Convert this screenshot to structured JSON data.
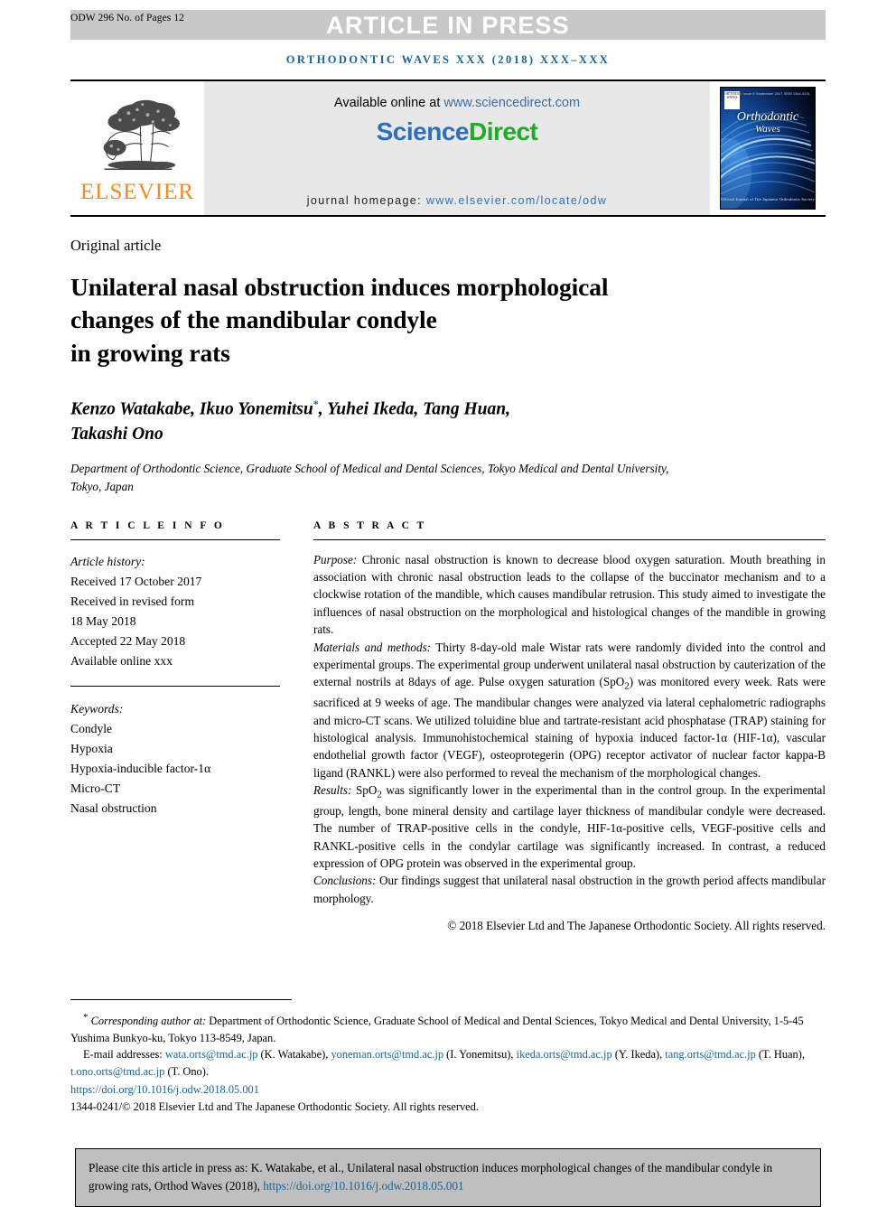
{
  "header": {
    "page_code": "ODW 296 No. of Pages 12",
    "article_in_press": "ARTICLE IN PRESS",
    "journal_line": "ORTHODONTIC WAVES XXX (2018) XXX–XXX",
    "band_color": "#c8c8c8",
    "journal_line_color": "#1a6496"
  },
  "banner": {
    "publisher": "ELSEVIER",
    "publisher_color": "#f08a24",
    "available_prefix": "Available online at ",
    "available_url": "www.sciencedirect.com",
    "sciencedirect_part1": "Science",
    "sciencedirect_part2": "Direct",
    "sciencedirect_color1": "#2f6fb5",
    "sciencedirect_color2": "#1faa2c",
    "homepage_label": "journal homepage: ",
    "homepage_url": "www.elsevier.com/locate/odw",
    "cover": {
      "title_line1": "Orthodontic",
      "title_line2": "Waves",
      "badge_text": "ORTHODONTIC WAVES",
      "top_line": "Volume XX Issue X  September 2017  ISSN 1344-0241",
      "bottom_line": "Official Journal of The Japanese Orthodontic Society"
    }
  },
  "article": {
    "kicker": "Original article",
    "title": "Unilateral nasal obstruction induces morphological changes of the mandibular condyle in growing rats",
    "title_lines": [
      "Unilateral nasal obstruction induces morphological",
      "changes of the mandibular condyle",
      "in growing rats"
    ],
    "authors_line1": "Kenzo Watakabe, Ikuo Yonemitsu",
    "authors_marker": "*",
    "authors_line1_rest": ", Yuhei Ikeda, Tang Huan,",
    "authors_line2": "Takashi Ono",
    "affiliation": "Department of Orthodontic Science, Graduate School of Medical and Dental Sciences, Tokyo Medical and Dental University, Tokyo, Japan"
  },
  "article_info": {
    "label": "A R T I C L E   I N F O",
    "history_heading": "Article history:",
    "history": [
      "Received 17 October 2017",
      "Received in revised form",
      "18 May 2018",
      "Accepted 22 May 2018",
      "Available online xxx"
    ],
    "keywords_heading": "Keywords:",
    "keywords": [
      "Condyle",
      "Hypoxia",
      "Hypoxia-inducible factor-1α",
      "Micro-CT",
      "Nasal obstruction"
    ]
  },
  "abstract": {
    "label": "A B S T R A C T",
    "sections": [
      {
        "lead": "Purpose:",
        "text": " Chronic nasal obstruction is known to decrease blood oxygen saturation. Mouth breathing in association with chronic nasal obstruction leads to the collapse of the buccinator mechanism and to a clockwise rotation of the mandible, which causes mandibular retrusion. This study aimed to investigate the influences of nasal obstruction on the morphological and histological changes of the mandible in growing rats."
      },
      {
        "lead": "Materials and methods:",
        "text": " Thirty 8-day-old male Wistar rats were randomly divided into the control and experimental groups. The experimental group underwent unilateral nasal obstruction by cauterization of the external nostrils at 8days of age. Pulse oxygen saturation (SpO2) was monitored every week. Rats were sacrificed at 9 weeks of age. The mandibular changes were analyzed via lateral cephalometric radiographs and micro-CT scans. We utilized toluidine blue and tartrate-resistant acid phosphatase (TRAP) staining for histological analysis. Immunohistochemical staining of hypoxia induced factor-1α (HIF-1α), vascular endothelial growth factor (VEGF), osteoprotegerin (OPG) receptor activator of nuclear factor kappa-B ligand (RANKL) were also performed to reveal the mechanism of the morphological changes."
      },
      {
        "lead": "Results:",
        "text": " SpO2 was significantly lower in the experimental than in the control group. In the experimental group, length, bone mineral density and cartilage layer thickness of mandibular condyle were decreased. The number of TRAP-positive cells in the condyle, HIF-1α-positive cells, VEGF-positive cells and RANKL-positive cells in the condylar cartilage was significantly increased. In contrast, a reduced expression of OPG protein was observed in the experimental group."
      },
      {
        "lead": "Conclusions:",
        "text": " Our findings suggest that unilateral nasal obstruction in the growth period affects mandibular morphology."
      }
    ],
    "copyright": "© 2018 Elsevier Ltd and The Japanese Orthodontic Society. All rights reserved."
  },
  "footnotes": {
    "corresponding_marker": "*",
    "corresponding_label": "Corresponding author at:",
    "corresponding_text": " Department of Orthodontic Science, Graduate School of Medical and Dental Sciences, Tokyo Medical and Dental University, 1-5-45 Yushima Bunkyo-ku, Tokyo 113-8549, Japan.",
    "email_label": "E-mail addresses:",
    "emails": [
      {
        "address": "wata.orts@tmd.ac.jp",
        "name": " (K. Watakabe), "
      },
      {
        "address": "yoneman.orts@tmd.ac.jp",
        "name": " (I. Yonemitsu), "
      },
      {
        "address": "ikeda.orts@tmd.ac.jp",
        "name": " (Y. Ikeda), "
      },
      {
        "address": "tang.orts@tmd.ac.jp",
        "name": " (T. Huan), "
      },
      {
        "address": "t.ono.orts@tmd.ac.jp",
        "name": " (T. Ono)."
      }
    ],
    "doi": "https://doi.org/10.1016/j.odw.2018.05.001",
    "issn_line": "1344-0241/© 2018 Elsevier Ltd and The Japanese Orthodontic Society. All rights reserved.",
    "link_color": "#1a6496"
  },
  "cite_box": {
    "text": "Please cite this article in press as: K. Watakabe, et al., Unilateral nasal obstruction induces morphological changes of the mandibular condyle in growing rats, Orthod Waves (2018), ",
    "doi": "https://doi.org/10.1016/j.odw.2018.05.001",
    "background": "#bfbfbf"
  }
}
